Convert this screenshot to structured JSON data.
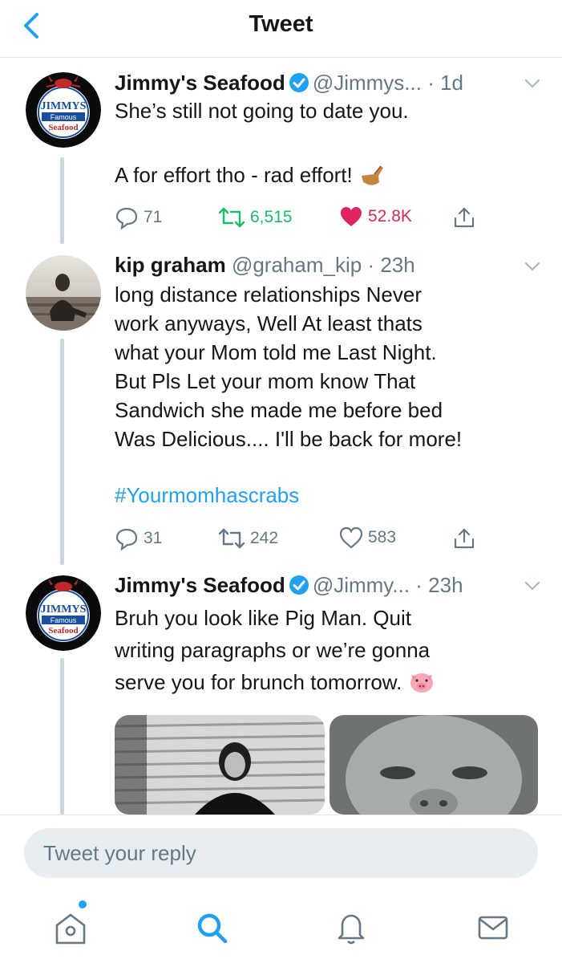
{
  "header": {
    "title": "Tweet"
  },
  "tweets": [
    {
      "name": "Jimmy's Seafood",
      "handle": "@Jimmys...",
      "time": "· 1d",
      "verified": true,
      "lines": [
        "She’s still not going to date you.",
        "",
        "A for effort tho - rad effort!"
      ],
      "emoji": "pointing-hand-emoji",
      "replies": "71",
      "retweets": "6,515",
      "likes": "52.8K",
      "liked": true,
      "retweeted": true
    },
    {
      "name": "kip graham",
      "handle": "@graham_kip",
      "time": "· 23h",
      "verified": false,
      "lines": [
        "long distance relationships Never",
        "work anyways, Well At least thats",
        "what your Mom told me Last Night.",
        "But Pls Let your mom know That",
        "Sandwich she made me before bed",
        "Was Delicious.... I'll be back for more!"
      ],
      "hashtag": "#Yourmomhascrabs",
      "replies": "31",
      "retweets": "242",
      "likes": "583",
      "liked": false,
      "retweeted": false
    },
    {
      "name": "Jimmy's Seafood",
      "handle": "@Jimmy...",
      "time": "· 23h",
      "verified": true,
      "lines": [
        "Bruh you look like Pig Man. Quit",
        "writing paragraphs or we’re gonna",
        "serve you for brunch tomorrow."
      ],
      "emoji": "pig-face-emoji"
    }
  ],
  "logo": {
    "line1": "JIMMYS",
    "line2": "Famous",
    "line3": "Seafood"
  },
  "reply": {
    "placeholder": "Tweet your reply"
  },
  "tabbar": {
    "items": [
      "home-icon",
      "search-icon",
      "notifications-icon",
      "messages-icon"
    ]
  },
  "colors": {
    "accent": "#1da1f2",
    "retweet": "#17bf63",
    "like": "#e0245e",
    "muted": "#657786"
  }
}
